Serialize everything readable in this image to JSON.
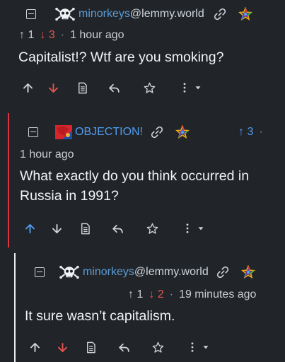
{
  "comments": [
    {
      "username": "minorkeys",
      "instance": "@lemmy.world",
      "upvotes": "1",
      "downvotes": "3",
      "time": "1 hour ago",
      "text": "Capitalist!? Wtf are you smoking?"
    },
    {
      "username": "OBJECTION!",
      "upvotes": "3",
      "time": "1 hour ago",
      "text": "What exactly do you think occurred in Russia in 1991?"
    },
    {
      "username": "minorkeys",
      "instance": "@lemmy.world",
      "upvotes": "1",
      "downvotes": "2",
      "time": "19 minutes ago",
      "text": "It sure wasn’t capitalism."
    }
  ],
  "glyphs": {
    "up_arrow": "↑",
    "down_arrow": "↓",
    "dot": "·"
  },
  "colors": {
    "background": "#212529",
    "link": "#5b9bd5",
    "upvote_active": "#4f9cf0",
    "downvote_active": "#e0544f",
    "thread_line_primary": "#dc3545",
    "thread_line_secondary": "#e9ecef"
  },
  "icons": [
    "collapse-icon",
    "skull-avatar-icon",
    "flag-avatar-icon",
    "link-icon",
    "rainbow-star-icon",
    "upvote-icon",
    "downvote-icon",
    "view-source-icon",
    "reply-icon",
    "save-star-icon",
    "more-icon",
    "dropdown-icon"
  ]
}
